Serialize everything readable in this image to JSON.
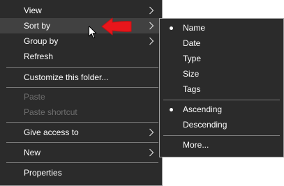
{
  "main_menu": {
    "view_label": "View",
    "sort_by_label": "Sort by",
    "group_by_label": "Group by",
    "refresh_label": "Refresh",
    "customize_label": "Customize this folder...",
    "paste_label": "Paste",
    "paste_shortcut_label": "Paste shortcut",
    "give_access_label": "Give access to",
    "new_label": "New",
    "properties_label": "Properties"
  },
  "sort_submenu": {
    "name_label": "Name",
    "date_label": "Date",
    "type_label": "Type",
    "size_label": "Size",
    "tags_label": "Tags",
    "ascending_label": "Ascending",
    "descending_label": "Descending",
    "more_label": "More..."
  },
  "colors": {
    "menu_background": "#2b2b2b",
    "highlight": "#414141",
    "disabled_text": "#6f6f6f",
    "annotation_arrow": "#e8161b"
  },
  "icons": {
    "chevron": "chevron-right-icon",
    "checked": "bullet-icon",
    "pointer": "mouse-cursor-icon",
    "annotation": "red-arrow-icon"
  }
}
